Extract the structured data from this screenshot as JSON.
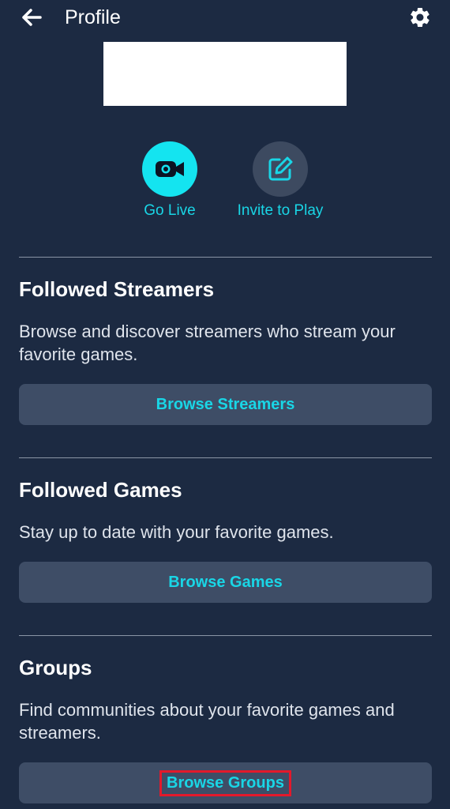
{
  "header": {
    "title": "Profile",
    "back_icon": "arrow-left-icon",
    "settings_icon": "gear-icon"
  },
  "actions": [
    {
      "label": "Go Live",
      "icon": "video-camera-icon"
    },
    {
      "label": "Invite to Play",
      "icon": "edit-square-icon"
    }
  ],
  "sections": {
    "streamers": {
      "title": "Followed Streamers",
      "description": "Browse and discover streamers who stream your favorite games.",
      "button": "Browse Streamers"
    },
    "games": {
      "title": "Followed Games",
      "description": "Stay up to date with your favorite games.",
      "button": "Browse Games"
    },
    "groups": {
      "title": "Groups",
      "description": "Find communities about your favorite games and streamers.",
      "button": "Browse Groups"
    }
  },
  "colors": {
    "background": "#1c2a42",
    "accent": "#19d6e6",
    "button_bg": "#3e4d66",
    "highlight": "#e3192b"
  }
}
